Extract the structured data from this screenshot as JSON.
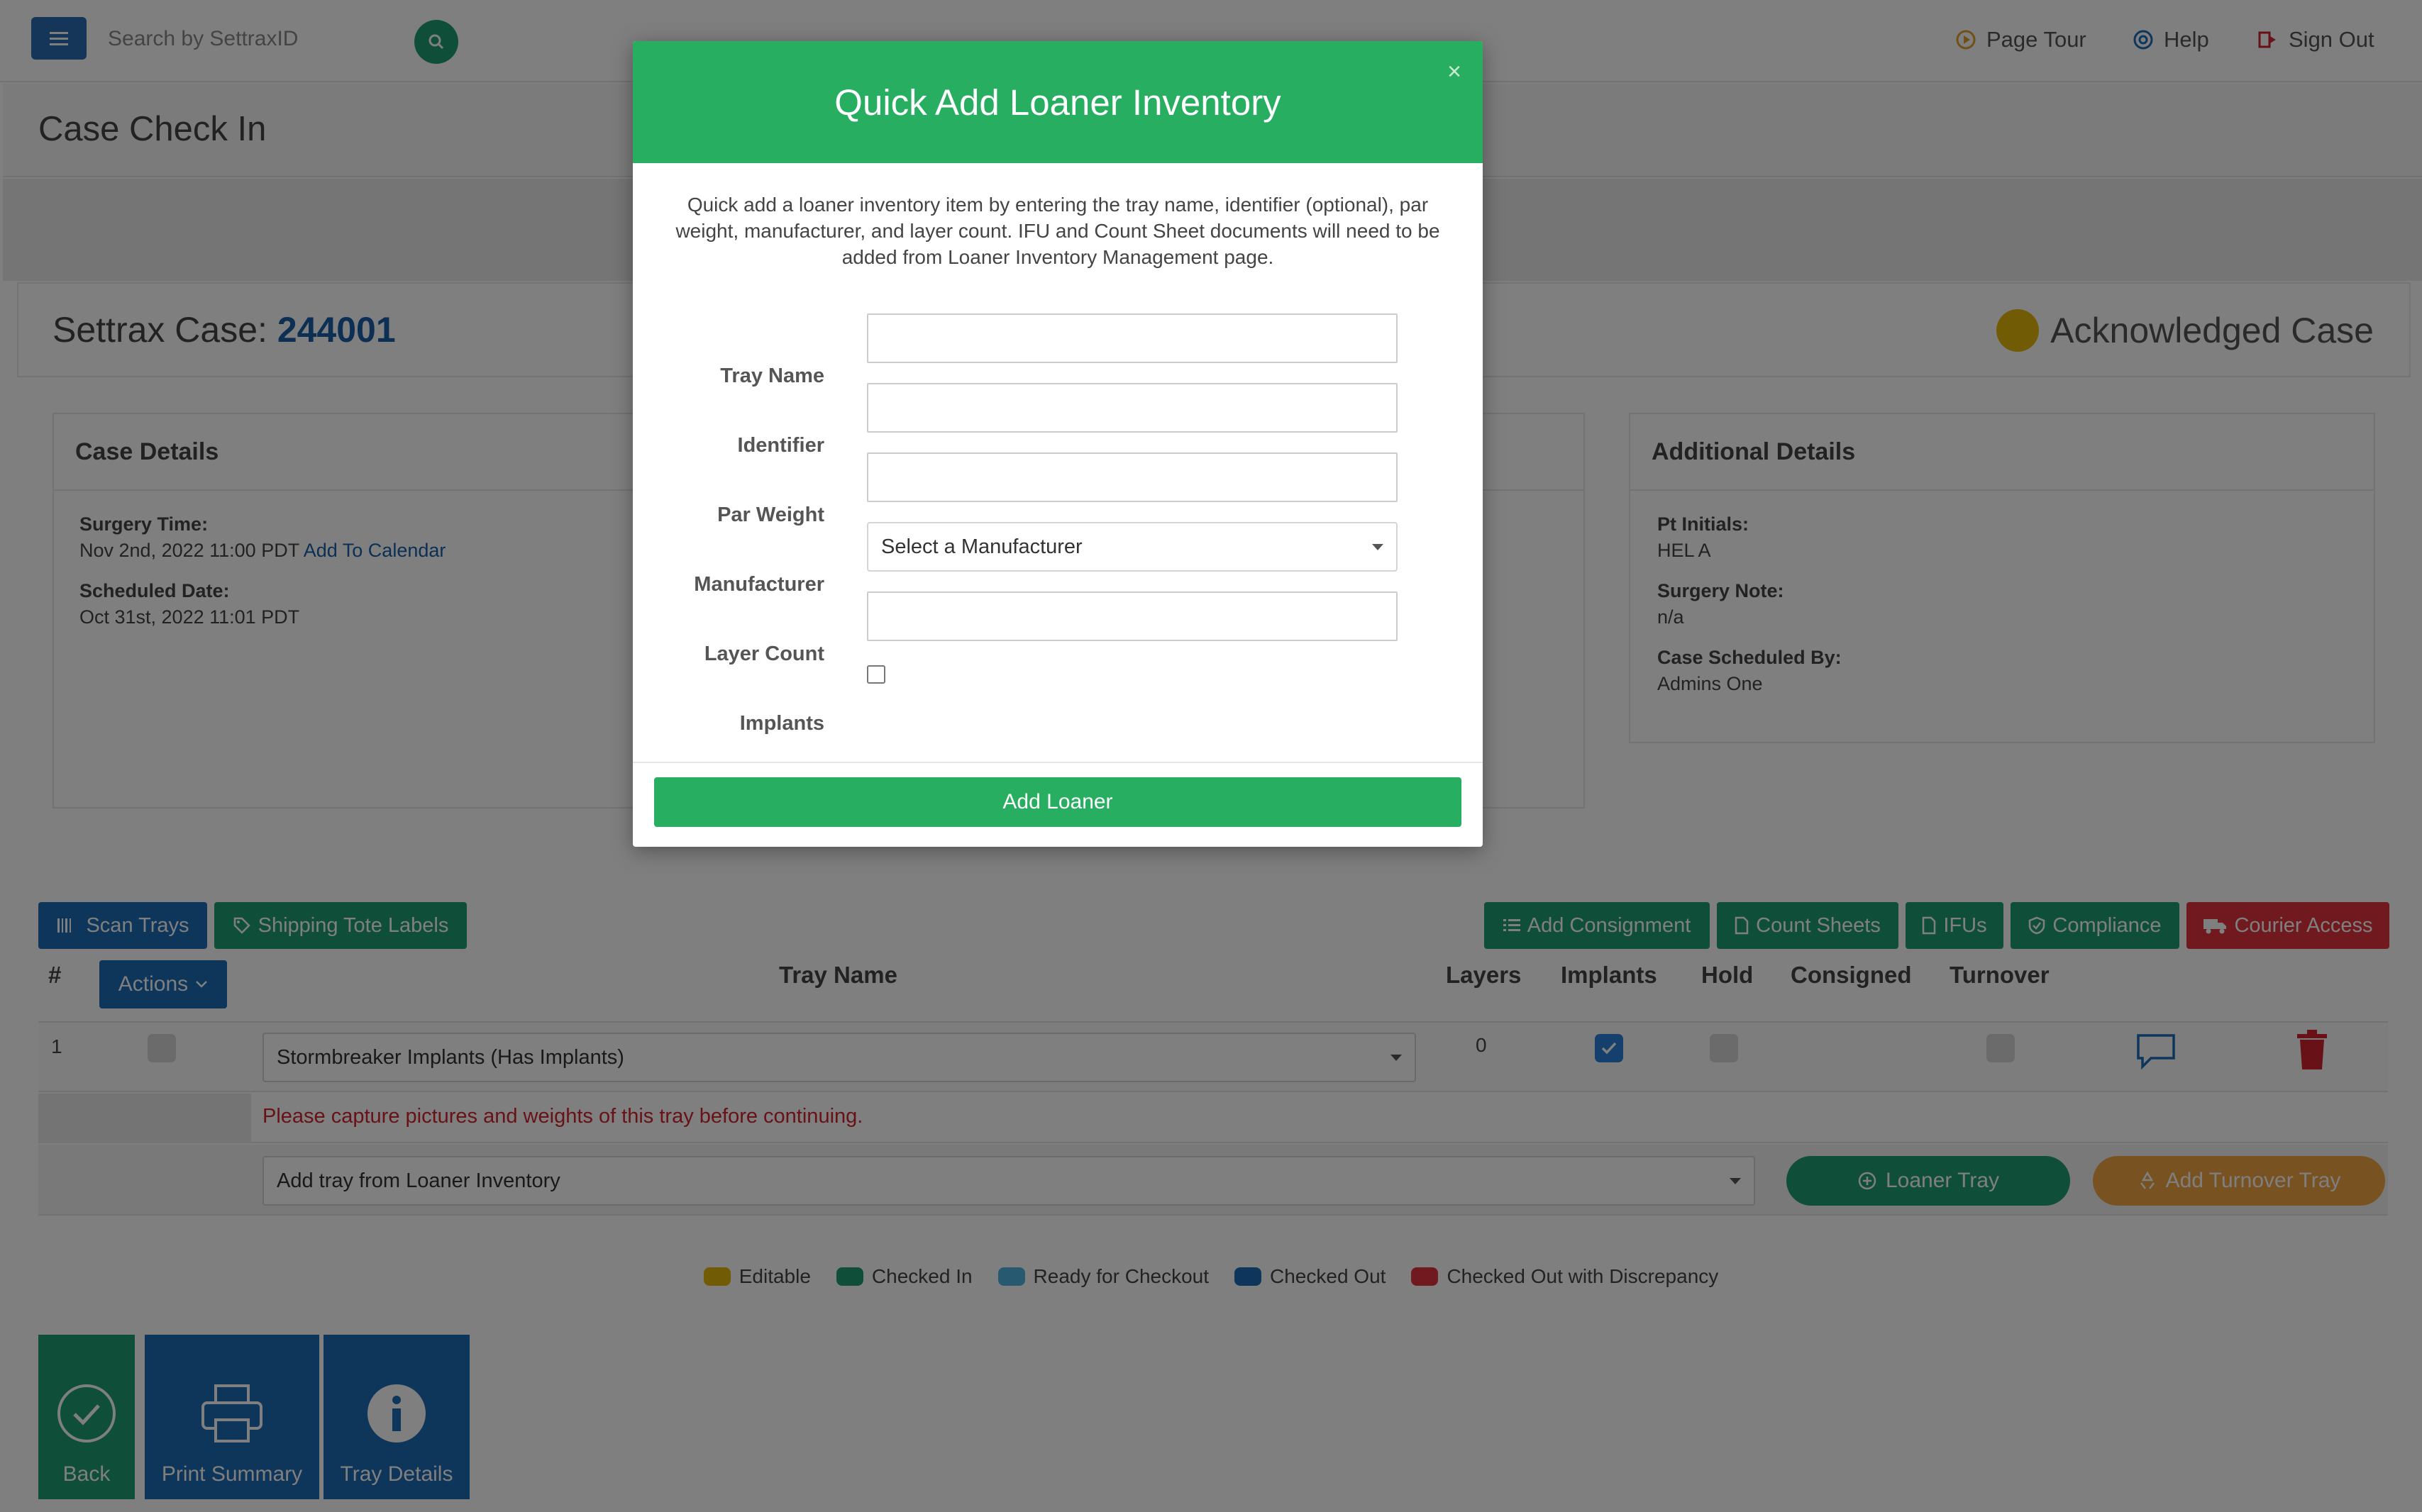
{
  "topbar": {
    "search_placeholder": "Search by SettraxID",
    "page_tour": "Page Tour",
    "help": "Help",
    "sign_out": "Sign Out"
  },
  "page": {
    "title": "Case Check In"
  },
  "case": {
    "label": "Settrax Case:",
    "number": "244001",
    "status": "Acknowledged Case",
    "status_color": "#e2b80b"
  },
  "case_details": {
    "heading": "Case Details",
    "surgery_time_label": "Surgery Time:",
    "surgery_time_value": "Nov 2nd, 2022 11:00 PDT",
    "add_to_calendar": "Add To Calendar",
    "scheduled_date_label": "Scheduled Date:",
    "scheduled_date_value": "Oct 31st, 2022 11:01 PDT"
  },
  "additional_details": {
    "heading": "Additional Details",
    "pt_initials_label": "Pt Initials:",
    "pt_initials_value": "HEL A",
    "surgery_note_label": "Surgery Note:",
    "surgery_note_value": "n/a",
    "scheduled_by_label": "Case Scheduled By:",
    "scheduled_by_value": "Admins One"
  },
  "toolbar": {
    "scan_trays": "Scan Trays",
    "shipping_tote_labels": "Shipping Tote Labels",
    "add_consignment": "Add Consignment",
    "count_sheets": "Count Sheets",
    "ifus": "IFUs",
    "compliance": "Compliance",
    "courier_access": "Courier Access"
  },
  "table": {
    "columns": {
      "num": "#",
      "actions": "Actions",
      "tray_name": "Tray Name",
      "layers": "Layers",
      "implants": "Implants",
      "hold": "Hold",
      "consigned": "Consigned",
      "turnover": "Turnover"
    },
    "rows": [
      {
        "num": "1",
        "tray_name": "Stormbreaker Implants (Has Implants)",
        "layers": "0",
        "implants": true,
        "hold": false,
        "turnover": false
      }
    ],
    "warning": "Please capture pictures and weights of this tray before continuing.",
    "add_tray_placeholder": "Add tray from Loaner Inventory",
    "loaner_tray_btn": "Loaner Tray",
    "turnover_tray_btn": "Add Turnover Tray"
  },
  "legend": [
    {
      "label": "Editable",
      "color": "#e2b80b"
    },
    {
      "label": "Checked In",
      "color": "#1f9e74"
    },
    {
      "label": "Ready for Checkout",
      "color": "#4fb3e3"
    },
    {
      "label": "Checked Out",
      "color": "#1c6bb5"
    },
    {
      "label": "Checked Out with Discrepancy",
      "color": "#e0343f"
    }
  ],
  "bottom": {
    "back": "Back",
    "print_summary": "Print Summary",
    "tray_details": "Tray Details"
  },
  "modal": {
    "title": "Quick Add Loaner Inventory",
    "close": "×",
    "description": "Quick add a loaner inventory item by entering the tray name, identifier (optional), par weight, manufacturer, and layer count. IFU and Count Sheet documents will need to be added from Loaner Inventory Management page.",
    "tray_name_label": "Tray Name",
    "identifier_label": "Identifier",
    "par_weight_label": "Par Weight",
    "manufacturer_label": "Manufacturer",
    "manufacturer_placeholder": "Select a Manufacturer",
    "layer_count_label": "Layer Count",
    "implants_label": "Implants",
    "submit": "Add Loaner"
  }
}
